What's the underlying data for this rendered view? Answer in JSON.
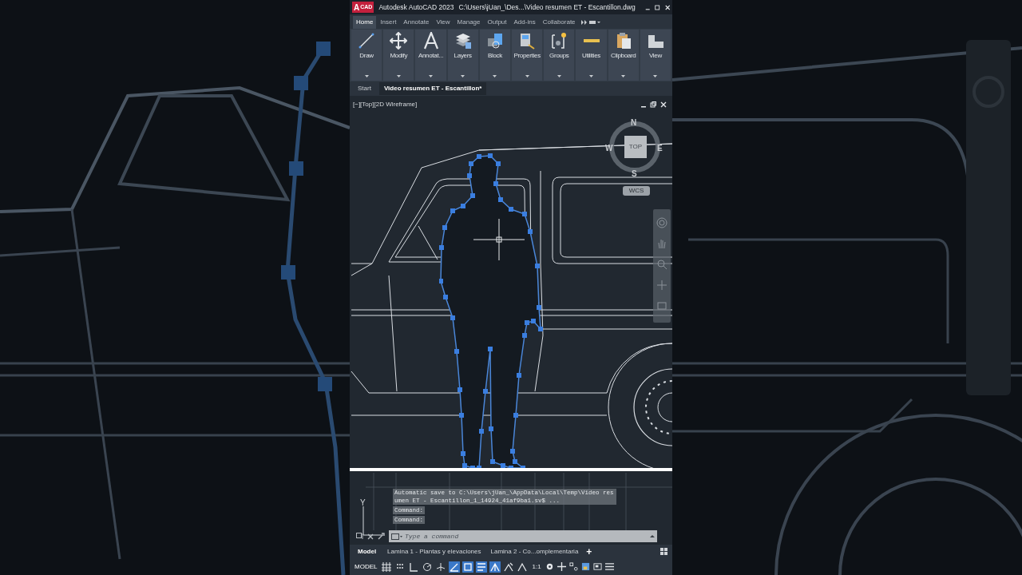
{
  "window": {
    "logo": "A",
    "logo_sub": "CAD",
    "app": "Autodesk AutoCAD 2023",
    "file": "C:\\Users\\jUan_\\Des...\\Video resumen ET - Escantillon.dwg"
  },
  "ribbon_tabs": [
    {
      "label": "Home",
      "selected": true
    },
    {
      "label": "Insert",
      "selected": false
    },
    {
      "label": "Annotate",
      "selected": false
    },
    {
      "label": "View",
      "selected": false
    },
    {
      "label": "Manage",
      "selected": false
    },
    {
      "label": "Output",
      "selected": false
    },
    {
      "label": "Add-ins",
      "selected": false
    },
    {
      "label": "Collaborate",
      "selected": false
    }
  ],
  "ribbon_panels": [
    {
      "label": "Draw"
    },
    {
      "label": "Modify"
    },
    {
      "label": "Annotat..."
    },
    {
      "label": "Layers"
    },
    {
      "label": "Block"
    },
    {
      "label": "Properties"
    },
    {
      "label": "Groups"
    },
    {
      "label": "Utilities"
    },
    {
      "label": "Clipboard"
    },
    {
      "label": "View"
    }
  ],
  "file_tabs": [
    {
      "label": "Start",
      "selected": false
    },
    {
      "label": "Video resumen ET - Escantillon*",
      "selected": true
    }
  ],
  "viewport": {
    "label": "[−][Top][2D Wireframe]",
    "viewcube": {
      "north": "N",
      "south": "S",
      "east": "E",
      "west": "W",
      "face": "TOP",
      "ucs": "WCS"
    },
    "axis_label": "Y"
  },
  "command_history": [
    "Automatic save to C:\\Users\\jUan_\\AppData\\Local\\Temp\\Video resumen ET - Escantillon_1_14924_41af9ba1.sv$ ...",
    "Command:",
    "Command:"
  ],
  "command_line": {
    "placeholder": "Type a command"
  },
  "layout_tabs": [
    {
      "label": "Model",
      "selected": true
    },
    {
      "label": "Lamina 1 - Plantas y elevaciones",
      "selected": false
    },
    {
      "label": "Lamina 2 - Co...omplementaria",
      "selected": false
    }
  ],
  "layout_add": "+",
  "status_bar": {
    "model": "MODEL",
    "scale": "1:1",
    "toggles": [
      {
        "kind": "grid",
        "on": false
      },
      {
        "kind": "snap",
        "on": false
      },
      {
        "kind": "ortho",
        "on": false
      },
      {
        "kind": "polar",
        "on": false
      },
      {
        "kind": "isodraft",
        "on": false
      },
      {
        "kind": "track",
        "on": true
      },
      {
        "kind": "osnap",
        "on": true
      },
      {
        "kind": "lineweight",
        "on": true
      },
      {
        "kind": "annovis",
        "on": true
      },
      {
        "kind": "autoscale",
        "on": false
      },
      {
        "kind": "annoscale",
        "on": false
      }
    ]
  }
}
